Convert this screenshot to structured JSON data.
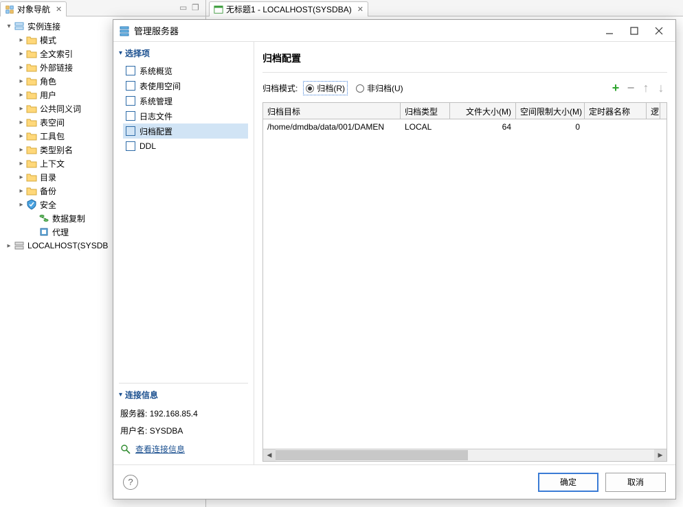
{
  "tabs": {
    "left": {
      "label": "对象导航",
      "icon": "navigator-icon"
    },
    "right": {
      "label": "无标题1 - LOCALHOST(SYSDBA)",
      "icon": "sql-icon"
    }
  },
  "tree": {
    "root": {
      "label": "实例连接",
      "icon": "server-icon"
    },
    "items": [
      {
        "label": "模式"
      },
      {
        "label": "全文索引"
      },
      {
        "label": "外部链接"
      },
      {
        "label": "角色"
      },
      {
        "label": "用户"
      },
      {
        "label": "公共同义词"
      },
      {
        "label": "表空间"
      },
      {
        "label": "工具包"
      },
      {
        "label": "类型别名"
      },
      {
        "label": "上下文"
      },
      {
        "label": "目录"
      },
      {
        "label": "备份"
      }
    ],
    "security": {
      "label": "安全",
      "icon": "shield-icon"
    },
    "replication": {
      "label": "数据复制",
      "icon": "sync-icon"
    },
    "agent": {
      "label": "代理",
      "icon": "agent-icon"
    },
    "host": {
      "label": "LOCALHOST(SYSDB"
    }
  },
  "dialog": {
    "title": "管理服务器",
    "side": {
      "head": "选择项",
      "options": [
        {
          "label": "系统概览"
        },
        {
          "label": "表使用空间"
        },
        {
          "label": "系统管理"
        },
        {
          "label": "日志文件"
        },
        {
          "label": "归档配置"
        },
        {
          "label": "DDL"
        }
      ],
      "selected": 4,
      "conn_head": "连接信息",
      "server_label": "服务器:",
      "server_value": "192.168.85.4",
      "user_label": "用户名:",
      "user_value": "SYSDBA",
      "view_link": "查看连接信息"
    },
    "main": {
      "title": "归档配置",
      "mode_label": "归档模式:",
      "radio_archive": "归档(R)",
      "radio_noarchive": "非归档(U)",
      "toolbar": {
        "add": "+",
        "del": "−",
        "up": "↑",
        "down": "↓"
      },
      "columns": [
        "归档目标",
        "归档类型",
        "文件大小(M)",
        "空间限制大小(M)",
        "定时器名称",
        "逻"
      ],
      "rows": [
        {
          "target": "/home/dmdba/data/001/DAMEN",
          "type": "LOCAL",
          "file_size": "64",
          "space_limit": "0",
          "timer": ""
        }
      ]
    },
    "footer": {
      "ok": "确定",
      "cancel": "取消"
    }
  }
}
